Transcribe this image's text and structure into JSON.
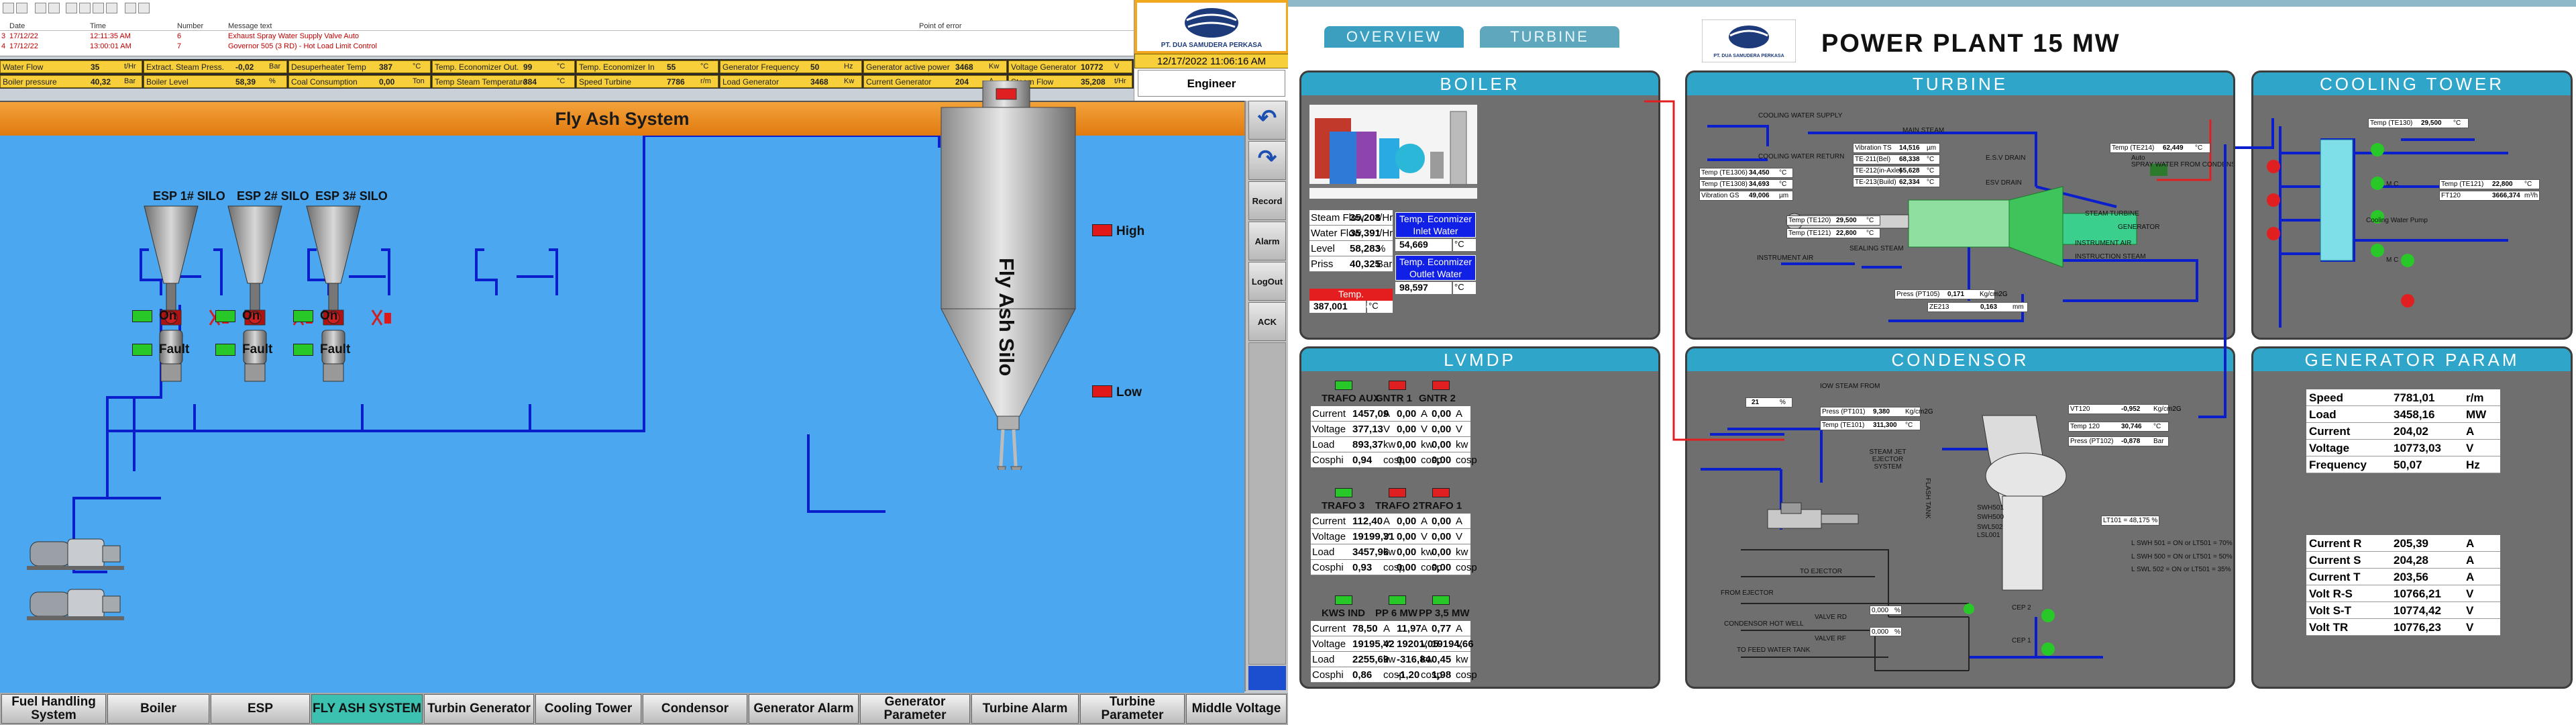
{
  "left": {
    "alarm_header": {
      "date": "Date",
      "time": "Time",
      "number": "Number",
      "message": "Message text",
      "point": "Point of error"
    },
    "alarms": [
      {
        "idx": "3",
        "date": "17/12/22",
        "time": "12:11:35 AM",
        "num": "6",
        "msg": "Exhaust Spray Water Supply Valve Auto"
      },
      {
        "idx": "4",
        "date": "17/12/22",
        "time": "13:00:01 AM",
        "num": "7",
        "msg": "Governor 505 (3 RD) - Hot Load Limit Control"
      }
    ],
    "company": "PT. DUA SAMUDERA PERKASA",
    "datetime": "12/17/2022 11:06:16 AM",
    "user": "Engineer",
    "pv": [
      {
        "label": "Water Flow",
        "value": "35",
        "unit": "t/Hr"
      },
      {
        "label": "Extract. Steam Press.",
        "value": "-0,02",
        "unit": "Bar"
      },
      {
        "label": "Desuperheater Temp",
        "value": "387",
        "unit": "°C"
      },
      {
        "label": "Temp. Economizer Out.",
        "value": "99",
        "unit": "°C"
      },
      {
        "label": "Temp. Economizer In",
        "value": "55",
        "unit": "°C"
      },
      {
        "label": "Generator Frequency",
        "value": "50",
        "unit": "Hz"
      },
      {
        "label": "Generator active power",
        "value": "3468",
        "unit": "Kw"
      },
      {
        "label": "Voltage Generator",
        "value": "10772",
        "unit": "V"
      },
      {
        "label": "Boiler pressure",
        "value": "40,32",
        "unit": "Bar"
      },
      {
        "label": "Boiler Level",
        "value": "58,39",
        "unit": "%"
      },
      {
        "label": "Coal Consumption",
        "value": "0,00",
        "unit": "Ton"
      },
      {
        "label": "Temp Steam Temperature",
        "value": "384",
        "unit": "°C"
      },
      {
        "label": "Speed Turbine",
        "value": "7786",
        "unit": "r/m"
      },
      {
        "label": "Load Generator",
        "value": "3468",
        "unit": "Kw"
      },
      {
        "label": "Current Generator",
        "value": "204",
        "unit": "A"
      },
      {
        "label": "Steam Flow",
        "value": "35,208",
        "unit": "t/Hr"
      }
    ],
    "title": "Fly Ash System",
    "silos": [
      "ESP 1# SILO",
      "ESP 2# SILO",
      "ESP 3# SILO"
    ],
    "on_label": "On",
    "fault_label": "Fault",
    "big_silo": "Fly Ash Silo",
    "high": "High",
    "low": "Low",
    "rnav": [
      "Record",
      "Alarm",
      "LogOut",
      "ACK"
    ],
    "bottom": [
      "Fuel Handling System",
      "Boiler",
      "ESP",
      "FLY ASH SYSTEM",
      "Turbin Generator",
      "Cooling Tower",
      "Condensor",
      "Generator Alarm",
      "Generator Parameter",
      "Turbine Alarm",
      "Turbine Parameter",
      "Middle Voltage"
    ]
  },
  "right": {
    "tabs": [
      "OVERVIEW",
      "TURBINE"
    ],
    "title": "POWER PLANT 15 MW",
    "company": "PT. DUA SAMUDERA PERKASA",
    "boiler": {
      "header": "BOILER",
      "rows": [
        [
          "Steam Flow",
          "35,208",
          "t/Hr"
        ],
        [
          "Water Flow",
          "35,391",
          "t/Hr"
        ],
        [
          "Level",
          "58,283",
          "%"
        ],
        [
          "Priss",
          "40,325",
          "Bar"
        ]
      ],
      "eco_in_label": "Temp. Econmizer Inlet Water",
      "eco_in_value": "54,669",
      "eco_in_unit": "°C",
      "eco_out_label": "Temp. Econmizer Outlet Water",
      "eco_out_value": "98,597",
      "eco_out_unit": "°C",
      "desup_label": "Temp. Desuperheater",
      "desup_value": "387,001",
      "desup_unit": "°C"
    },
    "turbine": {
      "header": "TURBINE",
      "labels": [
        "COOLING WATER SUPPLY",
        "COOLING WATER RETURN",
        "MAIN STEAM",
        "E.S.V DRAIN",
        "ESV DRAIN",
        "Auto",
        "SPRAY WATER FROM CONDENSATE PUMP DISCHARGE LINE",
        "STEAM TURBINE",
        "GENERATOR",
        "INSTRUMENT AIR",
        "SEALING STEAM",
        "INSTRUMENT AIR",
        "INSTRUCTION STEAM"
      ],
      "vib": [
        [
          "Vibration TS",
          "14,516",
          "µm"
        ],
        [
          "TE-211(Bel)",
          "68,338",
          "°C"
        ],
        [
          "TE-212(in-Axle)",
          "65,628",
          "°C"
        ],
        [
          "TE-213(Build)",
          "62,334",
          "°C"
        ]
      ],
      "temps_left": [
        [
          "Temp (TE1306)",
          "34,450",
          "°C"
        ],
        [
          "Temp (TE1308)",
          "34,693",
          "°C"
        ],
        [
          "Vibration GS",
          "49,006",
          "µm"
        ]
      ],
      "temps_mid": [
        [
          "Temp (TE120)",
          "29,500",
          "°C"
        ],
        [
          "Temp (TE121)",
          "22,800",
          "°C"
        ]
      ],
      "te214": [
        "Temp (TE214)",
        "62,449",
        "°C"
      ],
      "pt105": [
        "Press (PT105)",
        "0,171",
        "Kg/cm2G"
      ],
      "ze213": [
        "ZE213",
        "0,163",
        "mm"
      ]
    },
    "cooling": {
      "header": "COOLING TOWER",
      "te130": [
        "Temp (TE130)",
        "29,500",
        "°C"
      ],
      "te121": [
        "Temp (TE121)",
        "22,800",
        "°C"
      ],
      "ft120": [
        "FT120",
        "3666,374",
        "m³/h"
      ],
      "labels": [
        "M C",
        "Cooling Water Pump",
        "M C"
      ]
    },
    "lvmdp": {
      "header": "LVMDP",
      "groups": [
        {
          "names": [
            "TRAFO AUX",
            "GNTR 1",
            "GNTR 2"
          ],
          "ind": [
            "#28c828",
            "#e02020",
            "#e02020"
          ],
          "rows": [
            [
              "Current",
              "1457,09",
              "A",
              "0,00",
              "A",
              "0,00",
              "A"
            ],
            [
              "Voltage",
              "377,13",
              "V",
              "0,00",
              "V",
              "0,00",
              "V"
            ],
            [
              "Load",
              "893,37",
              "kw",
              "0,00",
              "kw",
              "0,00",
              "kw"
            ],
            [
              "Cosphi",
              "0,94",
              "cosp",
              "0,00",
              "cosp",
              "0,00",
              "cosp"
            ]
          ]
        },
        {
          "names": [
            "TRAFO 3",
            "TRAFO 2",
            "TRAFO 1"
          ],
          "ind": [
            "#28c828",
            "#e02020",
            "#e02020"
          ],
          "rows": [
            [
              "Current",
              "112,40",
              "A",
              "0,00",
              "A",
              "0,00",
              "A"
            ],
            [
              "Voltage",
              "19199,31",
              "V",
              "0,00",
              "V",
              "0,00",
              "V"
            ],
            [
              "Load",
              "3457,96",
              "kw",
              "0,00",
              "kw",
              "0,00",
              "kw"
            ],
            [
              "Cosphi",
              "0,93",
              "cosp",
              "0,00",
              "cosp",
              "0,00",
              "cosp"
            ]
          ]
        },
        {
          "names": [
            "KWS IND",
            "PP 6 MW",
            "PP 3,5 MW"
          ],
          "ind": [
            "#28c828",
            "#28c828",
            "#28c828"
          ],
          "rows": [
            [
              "Current",
              "78,50",
              "A",
              "11,97",
              "A",
              "0,77",
              "A"
            ],
            [
              "Voltage",
              "19195,42",
              "V",
              "19201,05",
              "V",
              "19194,66",
              "V"
            ],
            [
              "Load",
              "2255,69",
              "kw",
              "-316,84",
              "kw",
              "0,45",
              "kw"
            ],
            [
              "Cosphi",
              "0,86",
              "cosp",
              "-1,20",
              "cosp",
              "1,98",
              "cosp"
            ]
          ]
        }
      ]
    },
    "condensor": {
      "header": "CONDENSOR",
      "pt101": [
        "Press (PT101)",
        "9,380",
        "Kg/cm2G"
      ],
      "te101": [
        "Temp (TE101)",
        "311,300",
        "°C"
      ],
      "vt120": [
        "VT120",
        "-0,952",
        "Kg/cm2G"
      ],
      "temp120": [
        "Temp 120",
        "30,746",
        "°C"
      ],
      "pt102": [
        "Press (PT102)",
        "-0,878",
        "Bar"
      ],
      "pct": "21",
      "pct_unit": "%",
      "lt101": "LT101 = 48,175 %",
      "labels": [
        "IOW STEAM FROM",
        "STEAM JET EJECTOR SYSTEM",
        "FLASH TANK",
        "TO EJECTOR",
        "FROM EJECTOR",
        "CONDENSOR HOT WELL",
        "TO FEED WATER TANK",
        "VALVE RD",
        "VALVE RF",
        "CEP 2",
        "CEP 1",
        "L SWH 501 = ON or LT501 = 70%",
        "L SWH 500 = ON or LT501 = 50%",
        "L SWL 502 = ON or LT501 = 35%",
        "SWH501",
        "SWH500",
        "SWL502",
        "LSL001"
      ],
      "vr1": "0,000",
      "vr2": "0,000",
      "vr_unit": "%"
    },
    "gen": {
      "header": "GENERATOR PARAM",
      "rows": [
        [
          "Speed",
          "7781,01",
          "r/m"
        ],
        [
          "Load",
          "3458,16",
          "MW"
        ],
        [
          "Current",
          "204,02",
          "A"
        ],
        [
          "Voltage",
          "10773,03",
          "V"
        ],
        [
          "Frequency",
          "50,07",
          "Hz"
        ]
      ],
      "rows2": [
        [
          "Current R",
          "205,39",
          "A"
        ],
        [
          "Current S",
          "204,28",
          "A"
        ],
        [
          "Current T",
          "203,56",
          "A"
        ],
        [
          "Volt R-S",
          "10766,21",
          "V"
        ],
        [
          "Volt S-T",
          "10774,42",
          "V"
        ],
        [
          "Volt TR",
          "10776,23",
          "V"
        ]
      ]
    }
  }
}
